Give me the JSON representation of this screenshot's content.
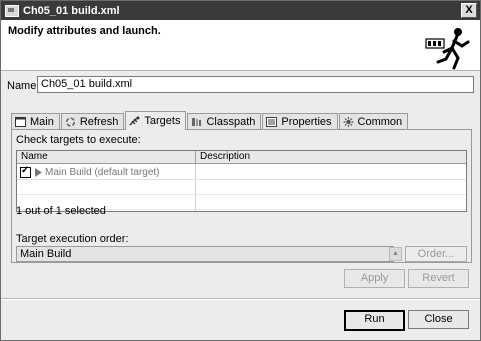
{
  "window": {
    "title": "Ch05_01 build.xml",
    "close_glyph": "X"
  },
  "banner": {
    "heading": "Modify attributes and launch."
  },
  "name_field": {
    "label": "Name:",
    "value": "Ch05_01 build.xml"
  },
  "tabs": [
    {
      "label": "Main",
      "icon": "main-icon"
    },
    {
      "label": "Refresh",
      "icon": "refresh-icon"
    },
    {
      "label": "Targets",
      "icon": "targets-icon",
      "active": true
    },
    {
      "label": "Classpath",
      "icon": "classpath-icon"
    },
    {
      "label": "Properties",
      "icon": "properties-icon"
    },
    {
      "label": "Common",
      "icon": "common-icon"
    }
  ],
  "targets": {
    "check_label": "Check targets to execute:",
    "columns": [
      "Name",
      "Description"
    ],
    "rows": [
      {
        "name": "Main Build (default target)",
        "description": "",
        "checked": true
      }
    ],
    "selection_status": "1 out of 1 selected",
    "order_label": "Target execution order:",
    "order_value": "Main Build",
    "order_button": "Order..."
  },
  "buttons": {
    "apply": "Apply",
    "revert": "Revert",
    "run": "Run",
    "close": "Close"
  }
}
